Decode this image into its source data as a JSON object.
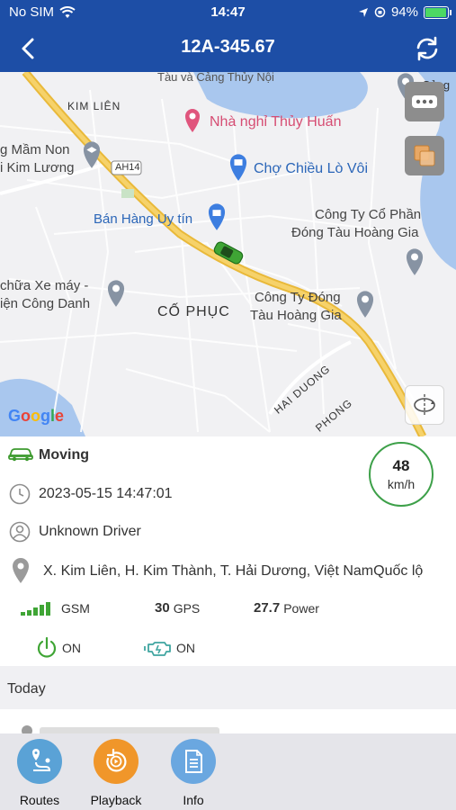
{
  "status_bar": {
    "carrier": "No SIM",
    "time": "14:47",
    "battery": "94%"
  },
  "header": {
    "title": "12A-345.67"
  },
  "map": {
    "labels": {
      "kim_lien": "KIM LIÊN",
      "nha_nghi": "Nhà nghỉ Thủy Huấn",
      "mam_non_1": "g Mầm Non",
      "mam_non_2": "i Kim Lương",
      "ah14": "AH14",
      "cho_chieu": "Chợ Chiều Lò Vôi",
      "ban_hang": "Bán Hàng Uy tín",
      "cong_ty_1a": "Công Ty Cổ Phần",
      "cong_ty_1b": "Đóng Tàu Hoàng Gia",
      "xe_may_1": "chữa Xe máy -",
      "xe_may_2": "iện Công Danh",
      "co_phuc": "CỐ PHỤC",
      "cong_ty_2a": "Công Ty Đóng",
      "cong_ty_2b": "Tàu Hoàng Gia",
      "hai_duong": "HAI DUONG",
      "phong": "PHONG",
      "top_partial": "Tàu và Cảng Thủy Nội",
      "cang": "Cảng",
      "google": "Google"
    }
  },
  "vehicle": {
    "status": "Moving",
    "speed": "48",
    "speed_unit": "km/h",
    "datetime": "2023-05-15 14:47:01",
    "driver": "Unknown Driver",
    "address": "X. Kim Liên, H. Kim Thành, T. Hải Dương, Việt NamQuốc lộ",
    "gsm_label": "GSM",
    "gps_value": "30",
    "gps_label": "GPS",
    "power_value": "27.7",
    "power_label": "Power",
    "power_state": "ON",
    "engine_state": "ON"
  },
  "section": {
    "today": "Today"
  },
  "bottom_nav": {
    "routes": "Routes",
    "playback": "Playback",
    "info": "Info"
  },
  "colors": {
    "header_bg": "#1d4ea6",
    "moving_green": "#3d9a2e",
    "routes_btn": "#5aa2d6",
    "playback_btn": "#f0962a",
    "info_btn": "#6aa7e0"
  }
}
